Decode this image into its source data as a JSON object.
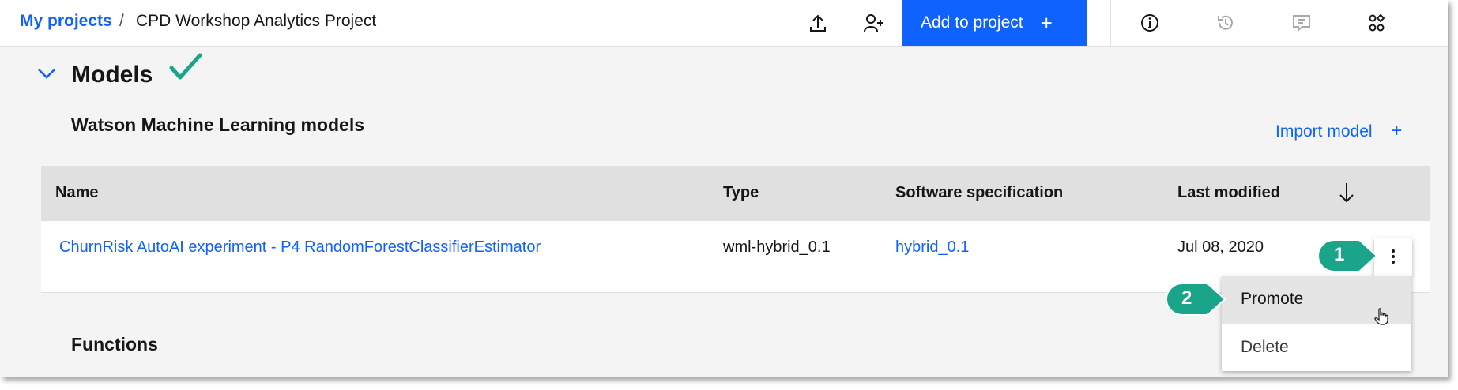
{
  "header": {
    "breadcrumb_root": "My projects",
    "breadcrumb_separator": "/",
    "project_name": "CPD Workshop Analytics Project",
    "add_to_project_label": "Add to project",
    "add_to_project_plus": "+",
    "icons": [
      "upload-icon",
      "add-collaborator-icon",
      "info-icon",
      "history-icon",
      "comment-icon",
      "apps-icon"
    ]
  },
  "section": {
    "title": "Models",
    "subsection_title": "Watson Machine Learning models",
    "import_label": "Import model",
    "import_plus": "+",
    "next_subsection_title": "Functions"
  },
  "table": {
    "columns": [
      "Name",
      "Type",
      "Software specification",
      "Last modified"
    ],
    "rows": [
      {
        "name": "ChurnRisk AutoAI experiment - P4 RandomForestClassifierEstimator",
        "type": "wml-hybrid_0.1",
        "software_spec": "hybrid_0.1",
        "last_modified": "Jul 08, 2020"
      }
    ]
  },
  "menu": {
    "items": [
      "Promote",
      "Delete"
    ]
  },
  "callouts": [
    "1",
    "2"
  ],
  "colors": {
    "accent": "#0f62fe",
    "callout": "#1aa58a",
    "check": "#1aa58a"
  }
}
